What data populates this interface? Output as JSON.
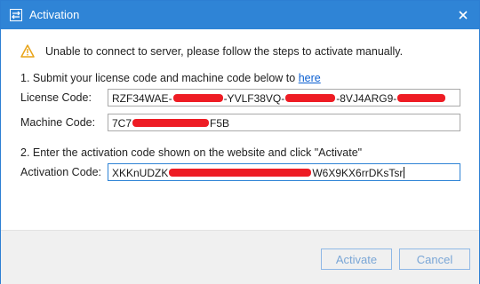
{
  "window": {
    "title": "Activation",
    "accent_color": "#2f84d6",
    "icons": {
      "app": "swap-arrows-icon",
      "close": "close-icon",
      "warning": "warning-triangle-icon"
    }
  },
  "message": {
    "text": "Unable to connect to server, please follow the steps to activate manually."
  },
  "step1": {
    "text": "1. Submit your license code and machine code below to",
    "link_text": "here"
  },
  "license": {
    "label": "License Code:",
    "part1": "RZF34WAE-",
    "part2": "-YVLF38VQ-",
    "part3": "-8VJ4ARG9-"
  },
  "machine": {
    "label": "Machine Code:",
    "prefix": "7C7",
    "suffix": "F5B"
  },
  "step2": {
    "text": "2. Enter the activation code shown on the website and click \"Activate\""
  },
  "activation": {
    "label": "Activation Code:",
    "prefix": "XKKnUDZK",
    "suffix": "W6X9KX6rrDKsTsr"
  },
  "buttons": {
    "activate": "Activate",
    "cancel": "Cancel"
  },
  "redaction_color": "#ee1c24"
}
